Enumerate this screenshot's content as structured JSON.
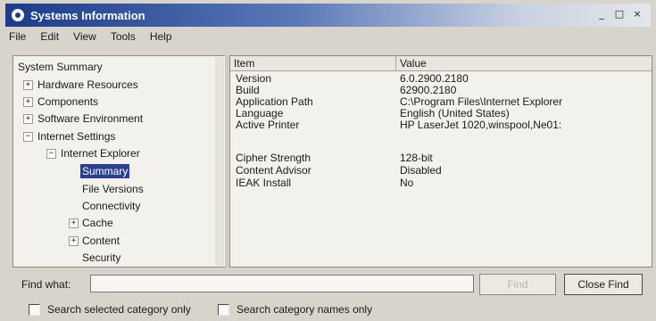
{
  "window": {
    "title": "Systems Information",
    "controls": {
      "minimize": "_",
      "maximize": "□",
      "close": "×"
    }
  },
  "menu": [
    "File",
    "Edit",
    "View",
    "Tools",
    "Help"
  ],
  "tree": {
    "items": [
      {
        "label": "System Summary",
        "expander": ""
      },
      {
        "label": "Hardware Resources",
        "expander": "+"
      },
      {
        "label": "Components",
        "expander": "+"
      },
      {
        "label": "Software Environment",
        "expander": "+"
      },
      {
        "label": "Internet Settings",
        "expander": "−"
      },
      {
        "label": "Internet Explorer",
        "expander": "−"
      },
      {
        "label": "Summary",
        "expander": "",
        "selected": true
      },
      {
        "label": "File Versions",
        "expander": ""
      },
      {
        "label": "Connectivity",
        "expander": ""
      },
      {
        "label": "Cache",
        "expander": "+"
      },
      {
        "label": "Content",
        "expander": "+"
      },
      {
        "label": "Security",
        "expander": ""
      }
    ]
  },
  "list": {
    "columns": {
      "item": "Item",
      "value": "Value"
    },
    "rows": [
      {
        "item": "Version",
        "value": "6.0.2900.2180"
      },
      {
        "item": "Build",
        "value": "62900.2180"
      },
      {
        "item": "Application Path",
        "value": "C:\\Program Files\\Internet Explorer"
      },
      {
        "item": "Language",
        "value": "English (United States)"
      },
      {
        "item": "Active Printer",
        "value": "HP LaserJet 1020,winspool,Ne01:"
      },
      {
        "item": "Cipher Strength",
        "value": "128-bit"
      },
      {
        "item": "Content Advisor",
        "value": "Disabled"
      },
      {
        "item": "IEAK Install",
        "value": "No"
      }
    ]
  },
  "find": {
    "label": "Find what:",
    "value": "",
    "find_button": "Find",
    "close_button": "Close Find",
    "check_selected": "Search selected category only",
    "check_names": "Search category names only"
  },
  "colors": {
    "title_bar": "#1c3b8a",
    "selection": "#2a3f8f",
    "pane_background": "#f3f1ec"
  }
}
